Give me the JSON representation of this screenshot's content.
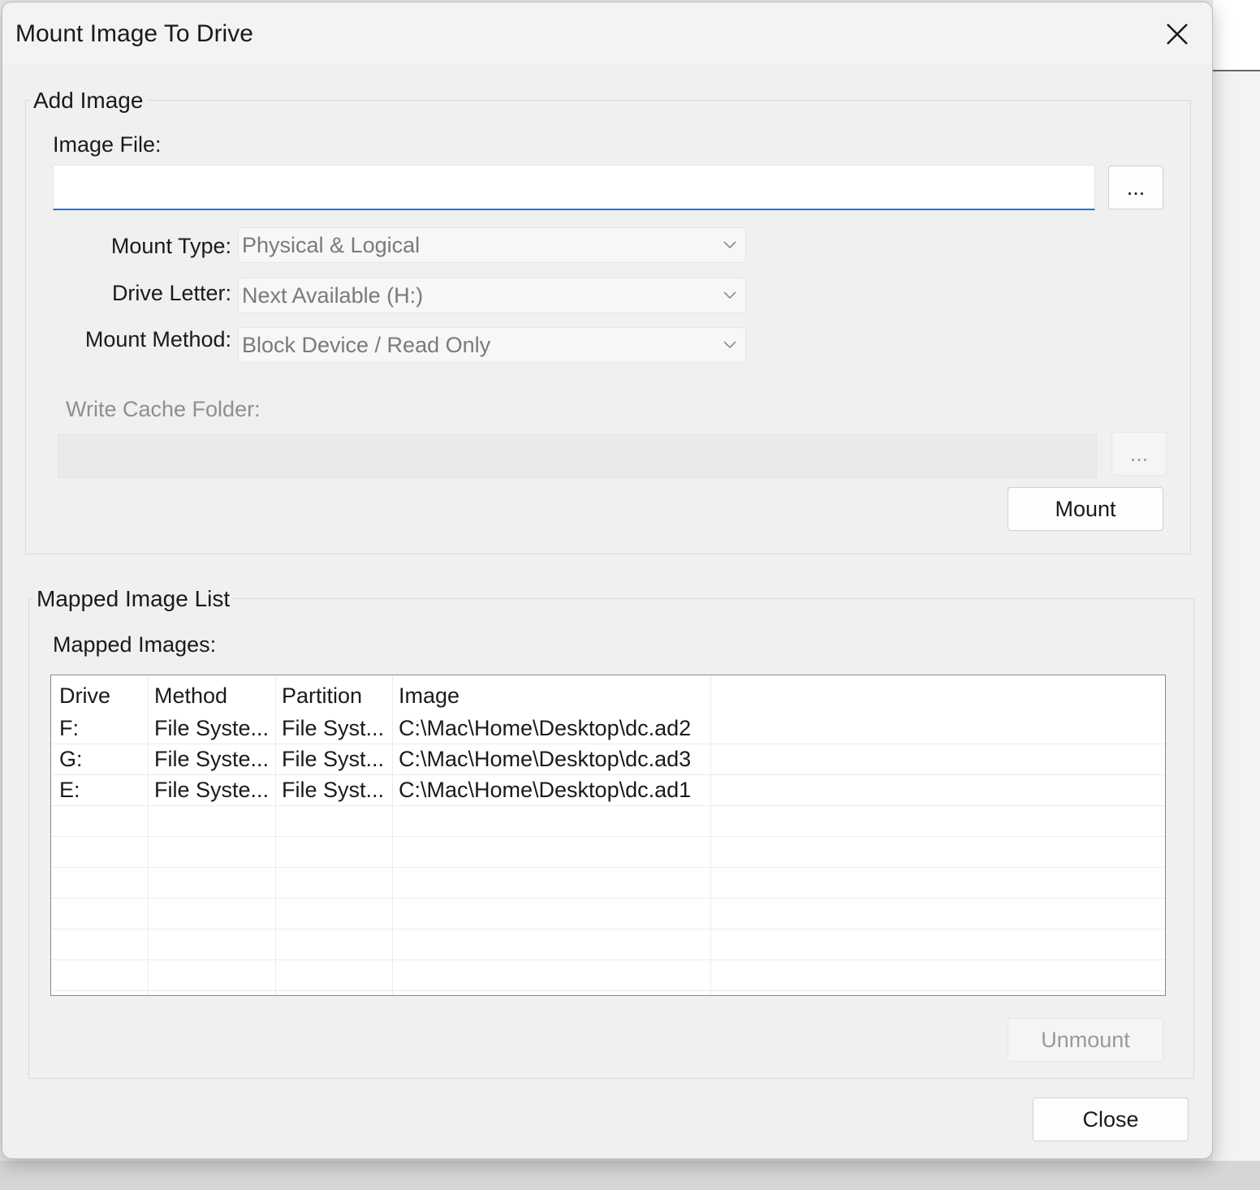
{
  "window": {
    "title": "Mount Image To Drive"
  },
  "add_image": {
    "legend": "Add Image",
    "image_file_label": "Image File:",
    "image_file_value": "",
    "browse_label": "...",
    "mount_type_label": "Mount Type:",
    "mount_type_value": "Physical & Logical",
    "drive_letter_label": "Drive Letter:",
    "drive_letter_value": "Next Available (H:)",
    "mount_method_label": "Mount Method:",
    "mount_method_value": "Block Device / Read Only",
    "write_cache_label": "Write Cache Folder:",
    "write_cache_value": "",
    "write_cache_browse_label": "...",
    "mount_button": "Mount"
  },
  "mapped_list": {
    "legend": "Mapped Image List",
    "label": "Mapped Images:",
    "columns": [
      "Drive",
      "Method",
      "Partition",
      "Image"
    ],
    "rows": [
      [
        "F:",
        "File Syste...",
        "File Syst...",
        "C:\\Mac\\Home\\Desktop\\dc.ad2"
      ],
      [
        "G:",
        "File Syste...",
        "File Syst...",
        "C:\\Mac\\Home\\Desktop\\dc.ad3"
      ],
      [
        "E:",
        "File Syste...",
        "File Syst...",
        "C:\\Mac\\Home\\Desktop\\dc.ad1"
      ]
    ],
    "unmount_button": "Unmount"
  },
  "footer": {
    "close_button": "Close"
  }
}
